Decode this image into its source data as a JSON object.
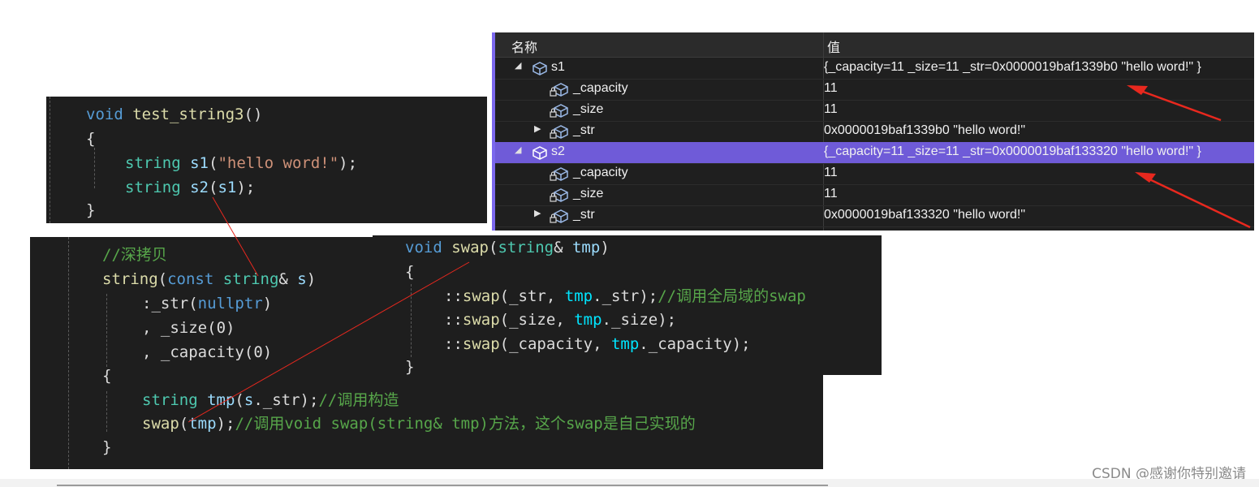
{
  "panel1": {
    "line0": [
      "void",
      " ",
      "test_string3",
      "()"
    ],
    "line1": "{",
    "line2": [
      "string",
      " ",
      "s1",
      "(",
      "\"hello word!\"",
      ");"
    ],
    "line3": [
      "string",
      " ",
      "s2",
      "(",
      "s1",
      ");"
    ],
    "line4": "}"
  },
  "panel2": {
    "line0": "//深拷贝",
    "line1": [
      "string",
      "(",
      "const",
      " ",
      "string",
      "&",
      " ",
      "s",
      ")"
    ],
    "line2": [
      ":",
      "_str",
      "(",
      "nullptr",
      ")"
    ],
    "line3": [
      ",",
      " ",
      "_size",
      "(",
      "0",
      ")"
    ],
    "line4": [
      ",",
      " ",
      "_capacity",
      "(",
      "0",
      ")"
    ],
    "line5": "{",
    "line6": [
      "string",
      " ",
      "tmp",
      "(",
      "s",
      ".",
      "_str",
      ");",
      "//调用构造"
    ],
    "line7": [
      "swap",
      "(",
      "tmp",
      ");",
      "//调用void swap(string& tmp)方法，这个swap是自己实现的"
    ],
    "line8": "}"
  },
  "panel3": {
    "line0": [
      "void",
      " ",
      "swap",
      "(",
      "string",
      "&",
      " ",
      "tmp",
      ")"
    ],
    "line1": "{",
    "line2": [
      "::",
      "swap",
      "(",
      "_str",
      ",",
      " ",
      "tmp",
      ".",
      "_str",
      ");",
      "//调用全局域的swap"
    ],
    "line3": [
      "::",
      "swap",
      "(",
      "_size",
      ",",
      " ",
      "tmp",
      ".",
      "_size",
      ");"
    ],
    "line4": [
      "::",
      "swap",
      "(",
      "_capacity",
      ",",
      " ",
      "tmp",
      ".",
      "_capacity",
      ");"
    ],
    "line5": "}"
  },
  "watch": {
    "col_name": "名称",
    "col_value": "值",
    "rows": [
      {
        "name": "s1",
        "value": "{_capacity=11 _size=11 _str=0x0000019baf1339b0 \"hello word!\" }"
      },
      {
        "name": "_capacity",
        "value": "11"
      },
      {
        "name": "_size",
        "value": "11"
      },
      {
        "name": "_str",
        "value": "0x0000019baf1339b0 \"hello word!\""
      },
      {
        "name": "s2",
        "value": "{_capacity=11 _size=11 _str=0x0000019baf133320 \"hello word!\" }"
      },
      {
        "name": "_capacity",
        "value": "11"
      },
      {
        "name": "_size",
        "value": "11"
      },
      {
        "name": "_str",
        "value": "0x0000019baf133320 \"hello word!\""
      }
    ],
    "selected_row": "s2"
  },
  "watermark": "CSDN @感谢你特别邀请",
  "colors": {
    "editor_bg": "#1e1e1e",
    "keyword": "#569cd6",
    "type": "#4ec9b0",
    "function": "#dcdcaa",
    "string": "#ce9178",
    "comment": "#57a64a",
    "selection": "#6f5bd8",
    "annotation_red": "#e8281e"
  },
  "icons": {
    "variable": "cube-variable-icon",
    "member": "lock-member-icon",
    "expanded": "triangle-expanded-icon",
    "collapsed": "triangle-collapsed-icon"
  }
}
